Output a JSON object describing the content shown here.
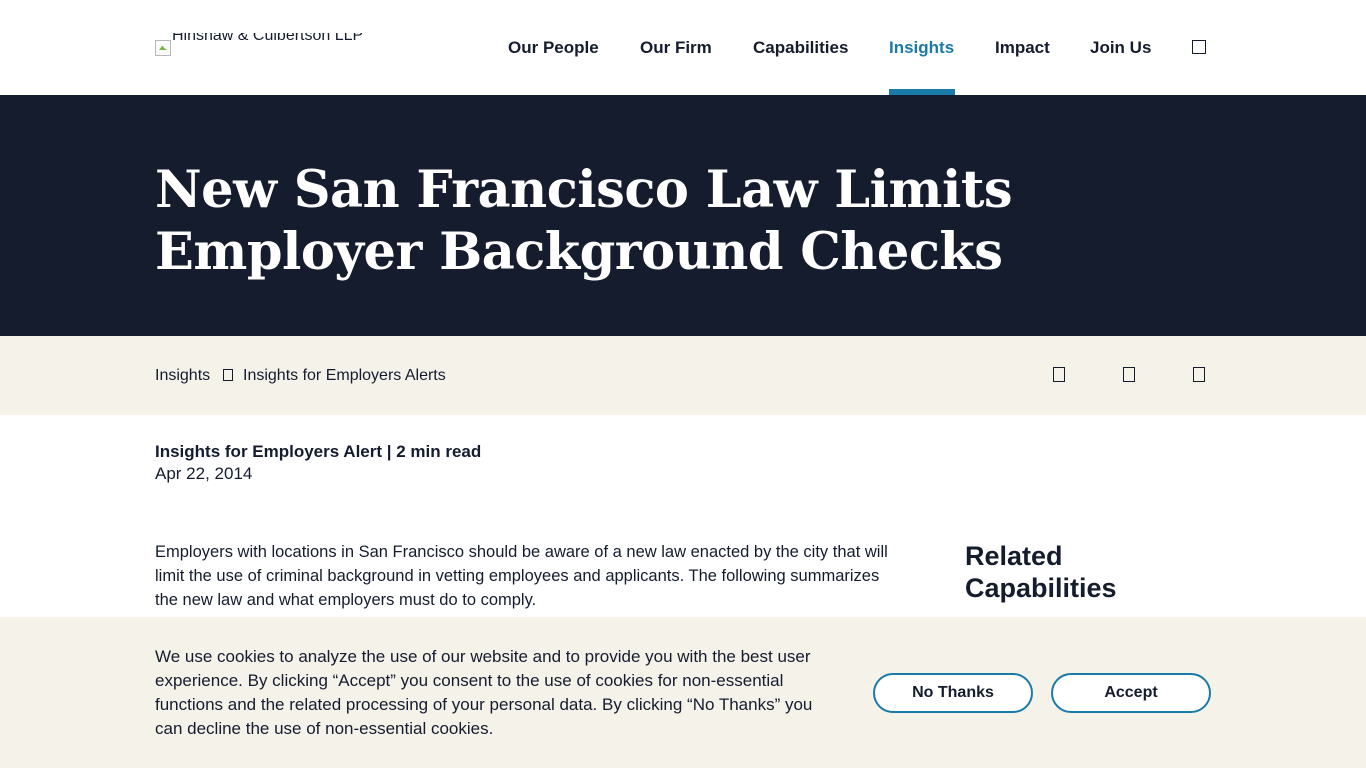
{
  "header": {
    "logo_alt": "Hinshaw & Culbertson LLP",
    "nav": [
      {
        "label": "Our People"
      },
      {
        "label": "Our Firm"
      },
      {
        "label": "Capabilities"
      },
      {
        "label": "Insights"
      },
      {
        "label": "Impact"
      },
      {
        "label": "Join Us"
      }
    ],
    "active_nav": "Insights",
    "search_icon": "search-icon"
  },
  "hero": {
    "title": "New San Francisco Law Limits Employer Background Checks"
  },
  "breadcrumb": {
    "items": [
      "Insights",
      "Insights for Employers Alerts"
    ],
    "separator_icon": "chevron-right-icon",
    "share_icons": [
      "share-icon-1",
      "share-icon-2",
      "share-icon-3"
    ]
  },
  "article": {
    "meta": "Insights for Employers Alert | 2 min read",
    "date": "Apr 22, 2014",
    "body": "Employers with locations in San Francisco should be aware of a new law enacted by the city that will limit the use of criminal background in vetting employees and applicants. The following summarizes the new law and what employers must do to comply."
  },
  "sidebar": {
    "related_title": "Related Capabilities"
  },
  "cookie_banner": {
    "text": "We use cookies to analyze the use of our website and to provide you with the best user experience. By clicking “Accept” you consent to the use of cookies for non-essential functions and the related processing of your personal data. By clicking “No Thanks” you can decline the use of non-essential cookies.",
    "no_thanks_label": "No Thanks",
    "accept_label": "Accept"
  },
  "colors": {
    "navy": "#141c2e",
    "accent": "#1a7aa8",
    "cream": "#f5f2ea"
  }
}
